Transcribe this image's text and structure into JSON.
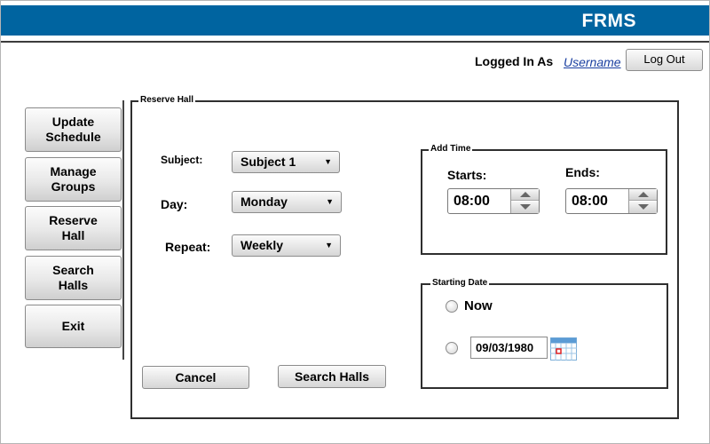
{
  "app": {
    "title": "FRMS"
  },
  "session": {
    "logged_in_as": "Logged In As",
    "username": "Username",
    "logout_label": "Log Out"
  },
  "nav": {
    "items": [
      {
        "label": "Update\nSchedule"
      },
      {
        "label": "Manage\nGroups"
      },
      {
        "label": "Reserve\nHall"
      },
      {
        "label": "Search\nHalls"
      },
      {
        "label": "Exit"
      }
    ]
  },
  "reserve": {
    "legend": "Reserve Hall",
    "subject_label": "Subject:",
    "subject_value": "Subject 1",
    "day_label": "Day:",
    "day_value": "Monday",
    "repeat_label": "Repeat:",
    "repeat_value": "Weekly",
    "cancel_label": "Cancel",
    "search_label": "Search Halls"
  },
  "add_time": {
    "legend": "Add Time",
    "starts_label": "Starts:",
    "starts_value": "08:00",
    "ends_label": "Ends:",
    "ends_value": "08:00"
  },
  "starting_date": {
    "legend": "Starting Date",
    "now_label": "Now",
    "date_value": "09/03/1980"
  },
  "colors": {
    "header": "#0064a0",
    "link": "#1a3fa0"
  }
}
